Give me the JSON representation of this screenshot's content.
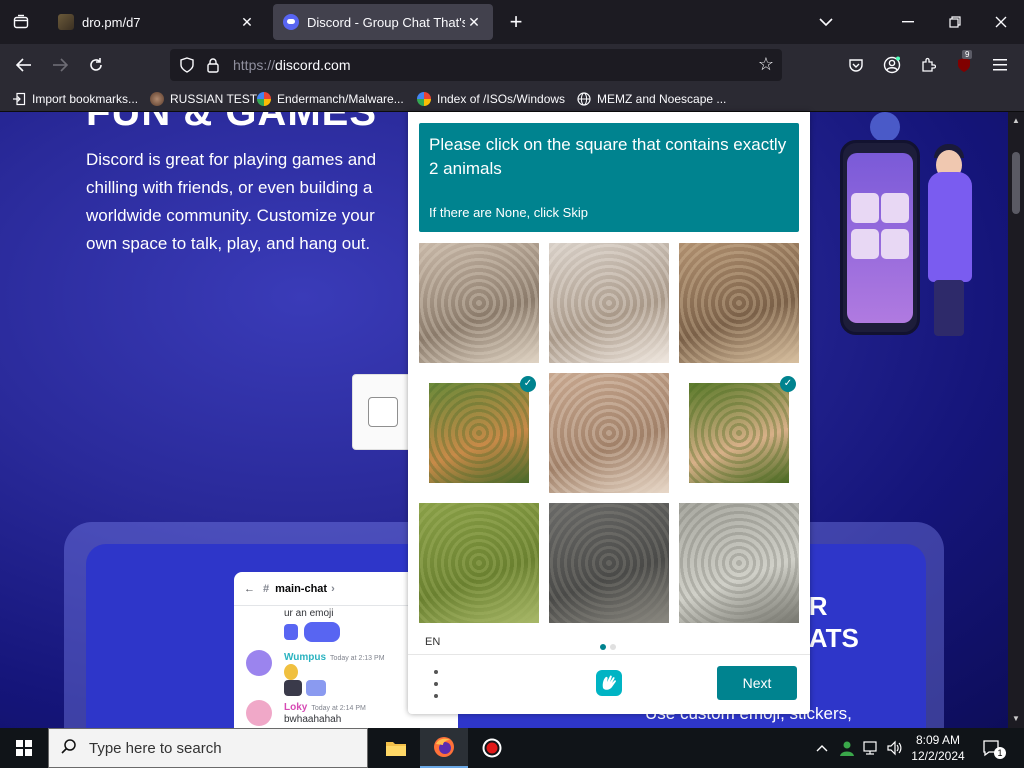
{
  "browser": {
    "tabs": [
      {
        "title": "dro.pm/d7",
        "active": false
      },
      {
        "title": "Discord - Group Chat That's All Fun & Games",
        "active": true
      }
    ],
    "url_prefix": "https://",
    "url_host": "discord.com",
    "extension_badge": "9",
    "bookmarks": [
      {
        "label": "Import bookmarks...",
        "icon": "import-icon"
      },
      {
        "label": "RUSSIAN TEST",
        "icon": "russian-test-icon"
      },
      {
        "label": "Endermanch/Malware...",
        "icon": "google-icon"
      },
      {
        "label": "Index of /ISOs/Windows",
        "icon": "google-icon"
      },
      {
        "label": "MEMZ and Noescape ...",
        "icon": "globe-icon"
      }
    ]
  },
  "page": {
    "hero_title": "FUN & GAMES",
    "hero_text": "Discord is great for playing games and chilling with friends, or even building a worldwide community. Customize your own space to talk, play, and hang out.",
    "chat": {
      "channel": "main-chat",
      "first_line": "ur an emoji",
      "messages": [
        {
          "user": "Wumpus",
          "time": "Today at 2:13 PM",
          "color": "#2bb3c0"
        },
        {
          "user": "Loky",
          "time": "Today at 2:14 PM",
          "text": "bwhaahahah",
          "color": "#d64ab4"
        }
      ]
    },
    "right_heading": "UR\nHATS\nN",
    "right_sub": "Use custom emoji, stickers,"
  },
  "captcha": {
    "prompt": "Please click on the square that contains exactly 2 animals",
    "hint": "If there are None, click Skip",
    "tiles": [
      {
        "name": "tile-room-dog",
        "selected": false,
        "colors": [
          "#c8b8a8",
          "#8a7a6a",
          "#e0d4c4"
        ]
      },
      {
        "name": "tile-kitchen-bird",
        "selected": false,
        "colors": [
          "#d8d0c8",
          "#a89888",
          "#f0e8e0"
        ]
      },
      {
        "name": "tile-restaurant",
        "selected": false,
        "colors": [
          "#b09070",
          "#7a6048",
          "#d8c0a0"
        ]
      },
      {
        "name": "tile-two-puppies-1",
        "selected": true,
        "colors": [
          "#6a8a3a",
          "#c88a48",
          "#4a6a2a"
        ]
      },
      {
        "name": "tile-cafe-pattern",
        "selected": false,
        "colors": [
          "#c8a890",
          "#a08068",
          "#e8d8c8"
        ]
      },
      {
        "name": "tile-two-puppies-2",
        "selected": true,
        "colors": [
          "#5a7a2a",
          "#d8b088",
          "#4a6a22"
        ]
      },
      {
        "name": "tile-grass-bird",
        "selected": false,
        "colors": [
          "#8aa048",
          "#6a8030",
          "#a8b868"
        ]
      },
      {
        "name": "tile-dog-chair",
        "selected": false,
        "colors": [
          "#6a6a68",
          "#4a4a48",
          "#8a8880"
        ]
      },
      {
        "name": "tile-couch-birds",
        "selected": false,
        "colors": [
          "#a8a8a0",
          "#d0d0c8",
          "#787870"
        ]
      }
    ],
    "lang": "EN",
    "next_label": "Next",
    "accent": "#00838f"
  },
  "taskbar": {
    "search_placeholder": "Type here to search",
    "time": "8:09 AM",
    "date": "12/2/2024",
    "notification_count": "1"
  }
}
